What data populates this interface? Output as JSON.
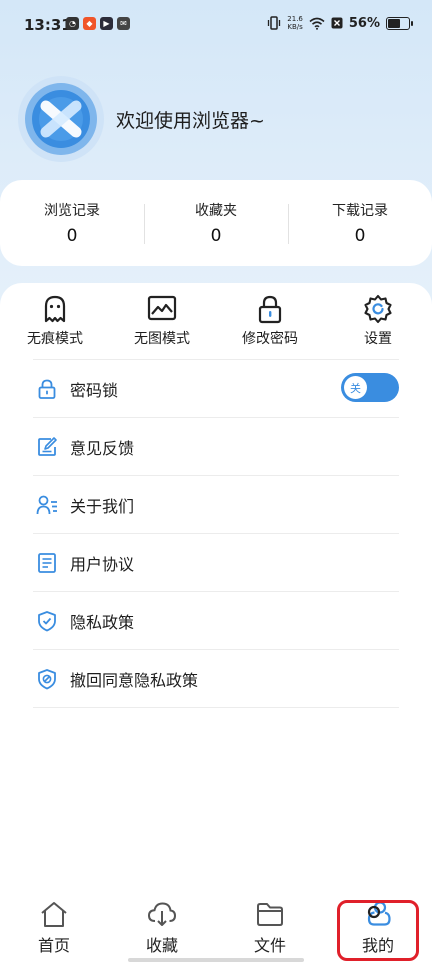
{
  "status_bar": {
    "time": "13:31",
    "net_speed_value": "21.6",
    "net_speed_unit": "KB/s",
    "battery_percent": "56%",
    "battery_level": 0.56
  },
  "profile": {
    "welcome": "欢迎使用浏览器~"
  },
  "stats": [
    {
      "label": "浏览记录",
      "value": "0"
    },
    {
      "label": "收藏夹",
      "value": "0"
    },
    {
      "label": "下载记录",
      "value": "0"
    }
  ],
  "shortcuts": [
    {
      "label": "无痕模式",
      "icon": "ghost-icon"
    },
    {
      "label": "无图模式",
      "icon": "image-icon"
    },
    {
      "label": "修改密码",
      "icon": "lock-icon"
    },
    {
      "label": "设置",
      "icon": "gear-icon"
    }
  ],
  "menu": {
    "items": [
      {
        "label": "密码锁",
        "icon": "lock-icon"
      },
      {
        "label": "意见反馈",
        "icon": "edit-icon"
      },
      {
        "label": "关于我们",
        "icon": "user-list-icon"
      },
      {
        "label": "用户协议",
        "icon": "document-icon"
      },
      {
        "label": "隐私政策",
        "icon": "shield-check-icon"
      },
      {
        "label": "撤回同意隐私政策",
        "icon": "shield-block-icon"
      }
    ],
    "password_lock_toggle": {
      "label": "关",
      "on": false
    }
  },
  "bottom_nav": {
    "items": [
      {
        "label": "首页",
        "icon": "home-icon"
      },
      {
        "label": "收藏",
        "icon": "cloud-download-icon"
      },
      {
        "label": "文件",
        "icon": "folder-icon"
      },
      {
        "label": "我的",
        "icon": "user-icon",
        "active": true
      }
    ]
  },
  "colors": {
    "accent": "#3a8de0",
    "highlight_border": "#e0202a"
  }
}
